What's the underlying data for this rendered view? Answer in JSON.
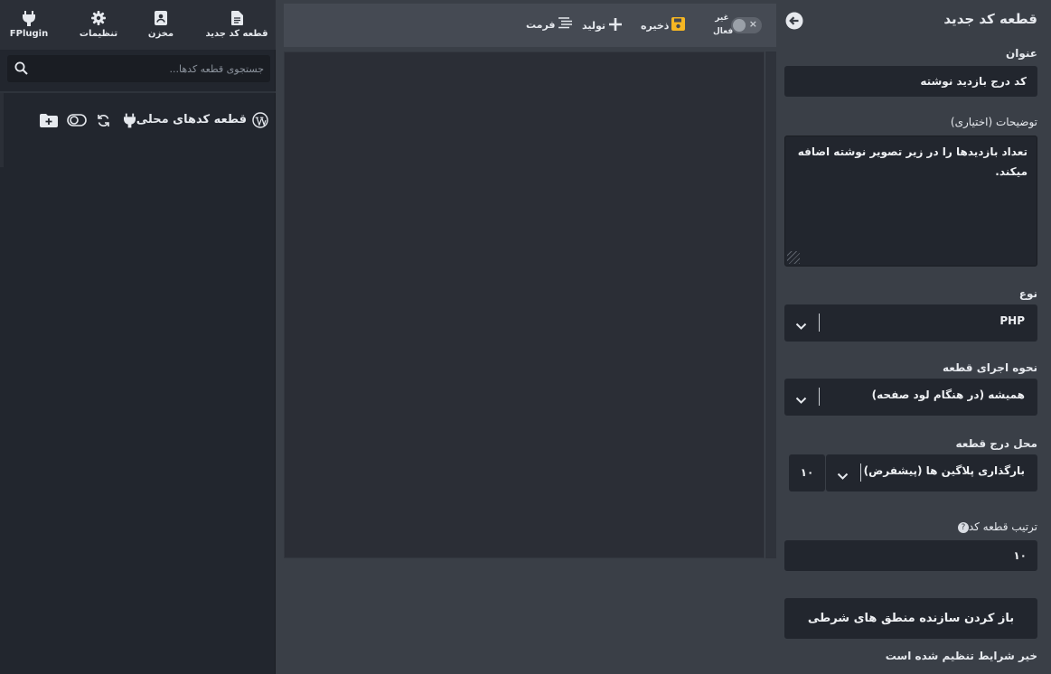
{
  "nav": {
    "new_snippet": "قطعه کد جدید",
    "repository": "مخزن",
    "settings": "تنظیمات",
    "fplugin": "FPlugin"
  },
  "search": {
    "placeholder": "جستجوی قطعه کدها..."
  },
  "tree": {
    "title": "قطعه کدهای محلی"
  },
  "toolbar": {
    "toggle_label": "غیر فعال",
    "save": "ذخیره",
    "generate": "تولید",
    "format": "فرمت"
  },
  "form": {
    "header": "قطعه کد جدید",
    "title_label": "عنوان",
    "title_value": "کد درج بازدید نوشته",
    "description_label": "توضیحات (اختیاری)",
    "description_value": "تعداد بازدیدها را در زیر تصویر نوشته اضافه میکند.",
    "type_label": "نوع",
    "type_value": "PHP",
    "exec_label": "نحوه اجرای قطعه",
    "exec_value": "همیشه (در هنگام لود صفحه)",
    "location_label": "محل درج قطعه",
    "location_value": "بارگذاری پلاگین ها (پیشفرض)",
    "location_priority": "۱۰",
    "order_label": "ترتیب قطعه کد",
    "order_value": "۱۰",
    "logic_button": "باز کردن سازنده منطق های شرطی",
    "conditions_status": "خیر شرایط تنظیم شده است"
  },
  "colors": {
    "save_icon": "#f5b623",
    "panel_dark": "#22262e",
    "toolbar": "#454a53"
  },
  "icons": [
    "file-icon",
    "repository-icon",
    "gear-icon",
    "plug-icon",
    "search-icon",
    "wordpress-icon",
    "add-folder-icon",
    "toggle-icon",
    "sync-icon",
    "save-icon",
    "plus-icon",
    "format-icon",
    "back-arrow-icon",
    "chevron-down-icon",
    "help-icon"
  ]
}
